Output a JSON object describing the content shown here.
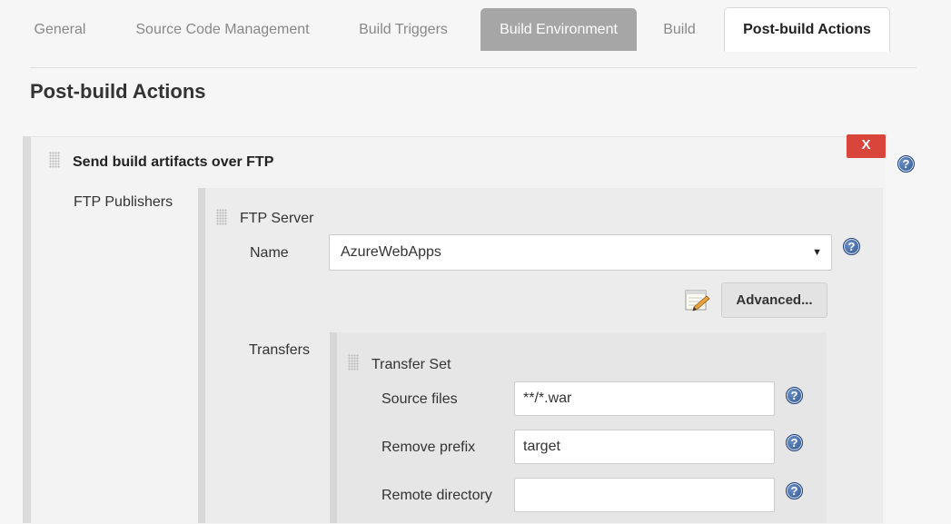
{
  "tabs": [
    {
      "label": "General"
    },
    {
      "label": "Source Code Management"
    },
    {
      "label": "Build Triggers"
    },
    {
      "label": "Build Environment"
    },
    {
      "label": "Build"
    },
    {
      "label": "Post-build Actions"
    }
  ],
  "active_tab": "Post-build Actions",
  "section_title": "Post-build Actions",
  "step": {
    "title": "Send build artifacts over FTP",
    "delete_label": "X",
    "publishers_label": "FTP Publishers",
    "server_title": "FTP Server",
    "name_label": "Name",
    "name_value": "AzureWebApps",
    "advanced_label": "Advanced...",
    "transfers_label": "Transfers",
    "transfer_set_title": "Transfer Set",
    "fields": {
      "source_files_label": "Source files",
      "source_files_value": "**/*.war",
      "remove_prefix_label": "Remove prefix",
      "remove_prefix_value": "target",
      "remote_directory_label": "Remote directory",
      "remote_directory_value": ""
    }
  },
  "help_glyph": "?",
  "icons": [
    "drag-handle-icon",
    "help-icon",
    "notepad-icon",
    "dropdown-arrow-icon"
  ],
  "colors": {
    "delete": "#d9453b",
    "help": "#2d5596",
    "active_tab_bg": "#ffffff",
    "env_tab_bg": "#a6a6a6"
  }
}
